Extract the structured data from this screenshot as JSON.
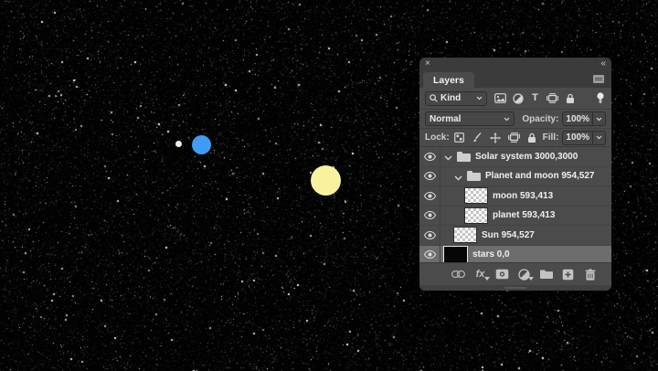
{
  "canvas": {
    "background_color": "#000000",
    "objects": {
      "sun": {
        "label": "sun",
        "color": "#f6f2a0"
      },
      "planet": {
        "label": "planet",
        "color": "#3e9df2"
      },
      "moon": {
        "label": "moon",
        "color": "#ededed"
      }
    }
  },
  "panel": {
    "window": {
      "close_glyph": "×",
      "collapse_glyph": "«"
    },
    "tab_label": "Layers",
    "filter_row": {
      "kind_label": "Kind"
    },
    "blend_row": {
      "mode_value": "Normal",
      "opacity_label": "Opacity:",
      "opacity_value": "100%"
    },
    "lock_row": {
      "lock_label": "Lock:",
      "fill_label": "Fill:",
      "fill_value": "100%"
    },
    "layers": [
      {
        "name": "Solar system 3000,3000",
        "type": "group",
        "visible": true,
        "selected": false
      },
      {
        "name": "Planet and moon 954,527",
        "type": "group",
        "visible": true,
        "selected": false
      },
      {
        "name": "moon 593,413",
        "type": "layer",
        "visible": true,
        "selected": false
      },
      {
        "name": "planet 593,413",
        "type": "layer",
        "visible": true,
        "selected": false
      },
      {
        "name": "Sun 954,527",
        "type": "layer",
        "visible": true,
        "selected": false
      },
      {
        "name": "stars 0,0",
        "type": "layer",
        "visible": true,
        "selected": true
      }
    ],
    "footer": {
      "fx_label": "fx"
    },
    "colors": {
      "selected_row": "#6d6d6d",
      "panel_bg": "#4b4b4b",
      "header_bg": "#3b3b3b"
    }
  }
}
